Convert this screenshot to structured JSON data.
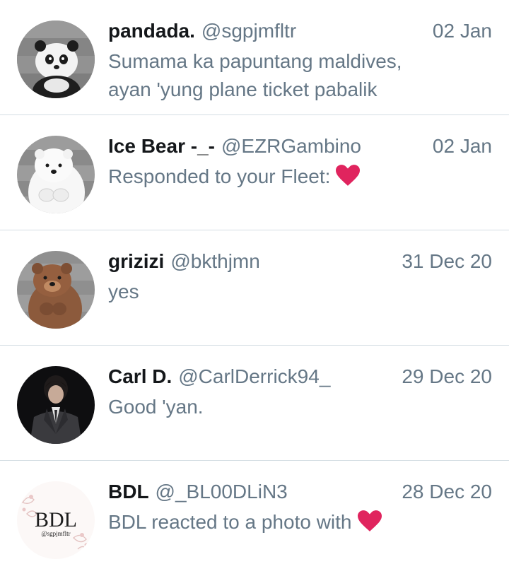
{
  "heart_color": "#e0245e",
  "conversations": [
    {
      "avatar_icon": "panda-avatar",
      "name": "pandada.",
      "handle": "@sgpjmfltr",
      "date": "02 Jan",
      "message": "Sumama ka papuntang maldives, ayan 'yung plane ticket pabalik",
      "heart": false
    },
    {
      "avatar_icon": "ice-bear-avatar",
      "name": "Ice Bear -_-",
      "handle": "@EZRGambino",
      "date": "02 Jan",
      "message": "Responded to your Fleet:",
      "heart": true
    },
    {
      "avatar_icon": "grizzly-bear-avatar",
      "name": "grizizi",
      "handle": "@bkthjmn",
      "date": "31 Dec 20",
      "message": "yes",
      "heart": false
    },
    {
      "avatar_icon": "person-in-suit-avatar",
      "name": "Carl D.",
      "handle": "@CarlDerrick94_",
      "date": "29 Dec 20",
      "message": "Good 'yan.",
      "heart": false
    },
    {
      "avatar_icon": "bdl-logo-avatar",
      "name": "BDL",
      "handle": "@_BL00DLiN3",
      "date": "28 Dec 20",
      "message": "BDL reacted to a photo with",
      "heart": true,
      "avatar_logo_text": "BDL",
      "avatar_logo_subtext": "@sgpjmfltr"
    }
  ]
}
